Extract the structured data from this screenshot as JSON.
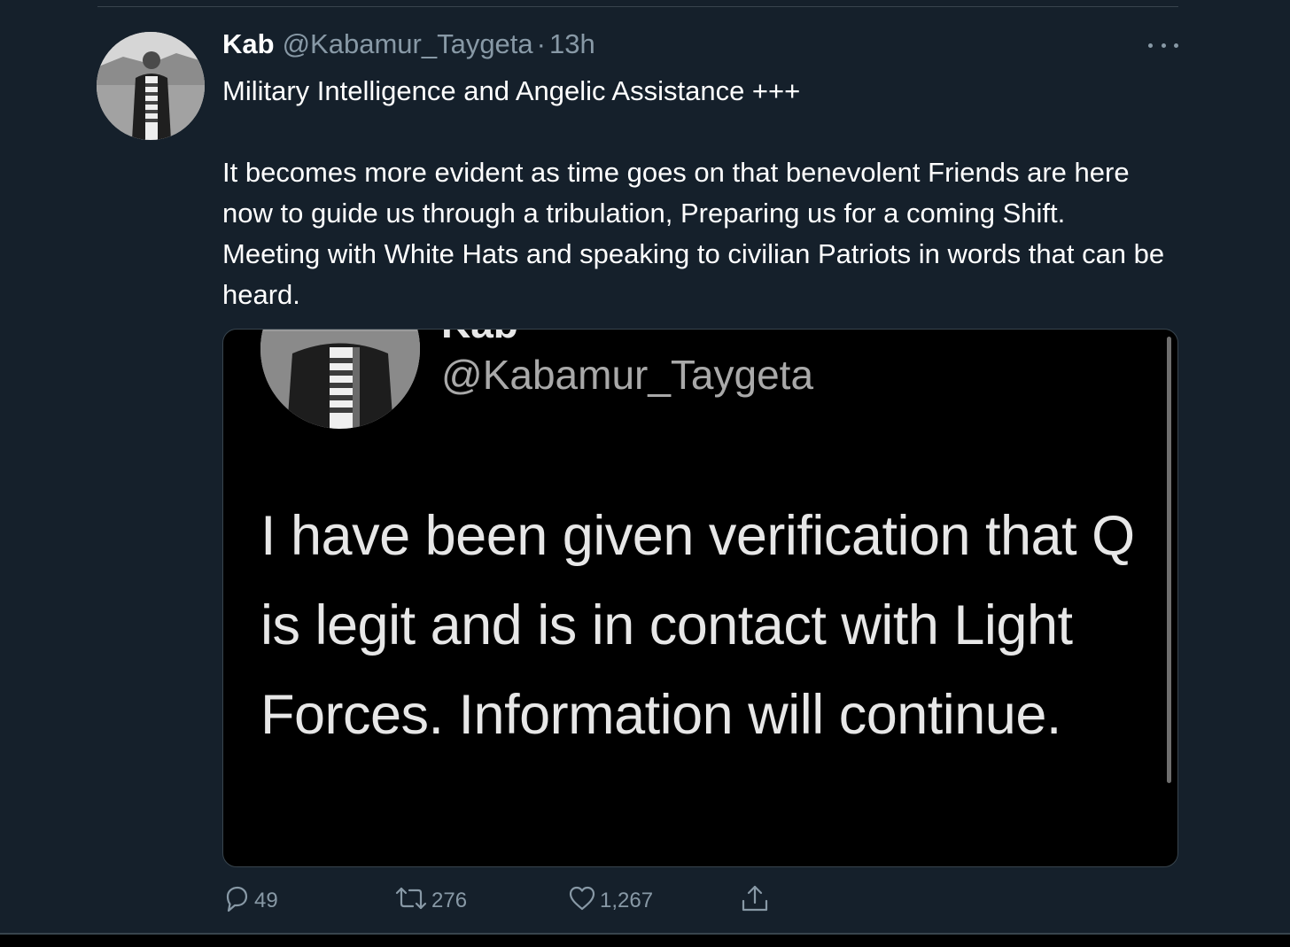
{
  "tweet": {
    "author_name": "Kab",
    "author_handle": "@Kabamur_Taygeta",
    "separator": "·",
    "timestamp": "13h",
    "text_lines": [
      "Military Intelligence and Angelic Assistance +++",
      "It becomes more evident as time goes on that benevolent Friends are here now to guide us through a tribulation, Preparing us for a coming Shift. Meeting with White Hats and speaking to civilian Patriots in words that can be heard."
    ],
    "media": {
      "cut_name": "Kab",
      "handle": "@Kabamur_Taygeta",
      "text": "I have been given verification that Q is legit and is in contact with Light Forces. Information will continue."
    },
    "actions": {
      "replies": "49",
      "retweets": "276",
      "likes": "1,267"
    }
  },
  "icons": {
    "more": "more-horizontal-icon",
    "reply": "reply-bubble-icon",
    "retweet": "retweet-icon",
    "like": "heart-icon",
    "share": "share-upload-icon"
  },
  "colors": {
    "background": "#15202b",
    "secondary_text": "#8899a6",
    "divider": "#38444d"
  }
}
